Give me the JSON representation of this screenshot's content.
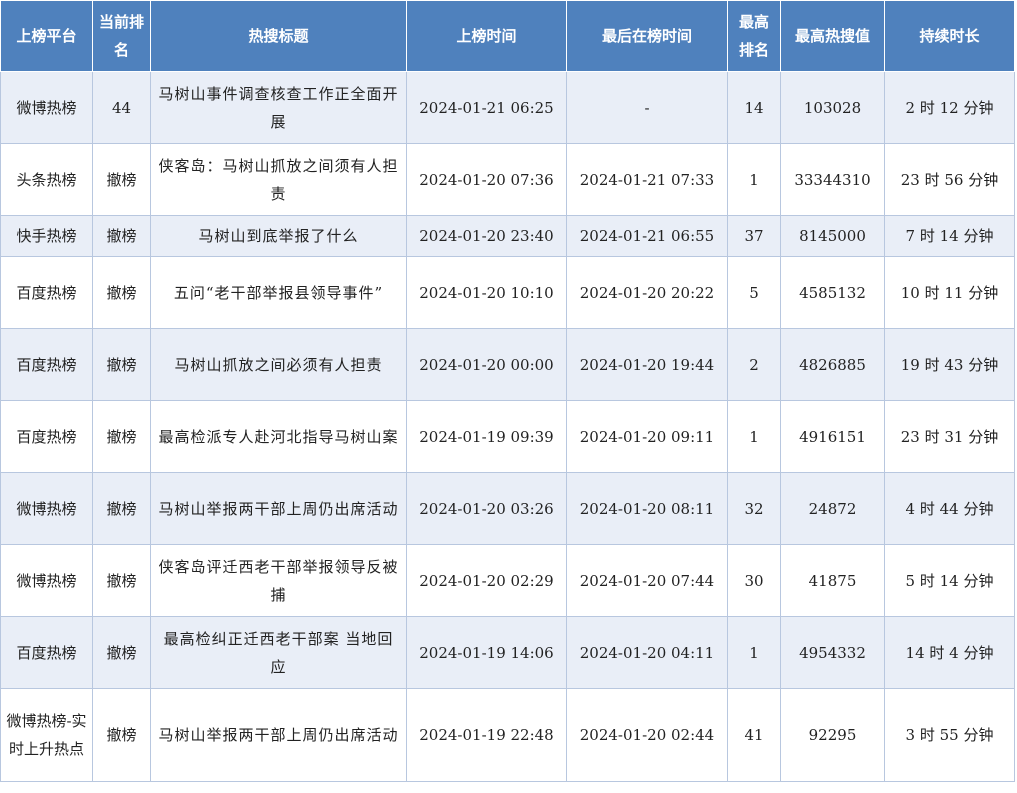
{
  "headers": {
    "platform": "上榜平台",
    "current_rank": "当前排名",
    "title": "热搜标题",
    "on_time": "上榜时间",
    "last_time": "最后在榜时间",
    "max_rank": "最高排名",
    "max_heat": "最高热搜值",
    "duration": "持续时长"
  },
  "rows": [
    {
      "platform": "微博热榜",
      "current_rank": "44",
      "title": "马树山事件调查核查工作正全面开展",
      "on_time": "2024-01-21 06:25",
      "last_time": "-",
      "max_rank": "14",
      "max_heat": "103028",
      "duration": "2 时 12 分钟"
    },
    {
      "platform": "头条热榜",
      "current_rank": "撤榜",
      "title": "侠客岛：马树山抓放之间须有人担责",
      "on_time": "2024-01-20 07:36",
      "last_time": "2024-01-21 07:33",
      "max_rank": "1",
      "max_heat": "33344310",
      "duration": "23 时 56 分钟"
    },
    {
      "platform": "快手热榜",
      "current_rank": "撤榜",
      "title": "马树山到底举报了什么",
      "on_time": "2024-01-20 23:40",
      "last_time": "2024-01-21 06:55",
      "max_rank": "37",
      "max_heat": "8145000",
      "duration": "7 时 14 分钟"
    },
    {
      "platform": "百度热榜",
      "current_rank": "撤榜",
      "title": "五问“老干部举报县领导事件”",
      "on_time": "2024-01-20 10:10",
      "last_time": "2024-01-20 20:22",
      "max_rank": "5",
      "max_heat": "4585132",
      "duration": "10 时 11 分钟"
    },
    {
      "platform": "百度热榜",
      "current_rank": "撤榜",
      "title": "马树山抓放之间必须有人担责",
      "on_time": "2024-01-20 00:00",
      "last_time": "2024-01-20 19:44",
      "max_rank": "2",
      "max_heat": "4826885",
      "duration": "19 时 43 分钟"
    },
    {
      "platform": "百度热榜",
      "current_rank": "撤榜",
      "title": "最高检派专人赴河北指导马树山案",
      "on_time": "2024-01-19 09:39",
      "last_time": "2024-01-20 09:11",
      "max_rank": "1",
      "max_heat": "4916151",
      "duration": "23 时 31 分钟"
    },
    {
      "platform": "微博热榜",
      "current_rank": "撤榜",
      "title": "马树山举报两干部上周仍出席活动",
      "on_time": "2024-01-20 03:26",
      "last_time": "2024-01-20 08:11",
      "max_rank": "32",
      "max_heat": "24872",
      "duration": "4 时 44 分钟"
    },
    {
      "platform": "微博热榜",
      "current_rank": "撤榜",
      "title": "侠客岛评迁西老干部举报领导反被捕",
      "on_time": "2024-01-20 02:29",
      "last_time": "2024-01-20 07:44",
      "max_rank": "30",
      "max_heat": "41875",
      "duration": "5 时 14 分钟"
    },
    {
      "platform": "百度热榜",
      "current_rank": "撤榜",
      "title": "最高检纠正迁西老干部案 当地回应",
      "on_time": "2024-01-19 14:06",
      "last_time": "2024-01-20 04:11",
      "max_rank": "1",
      "max_heat": "4954332",
      "duration": "14 时 4 分钟"
    },
    {
      "platform": "微博热榜-实时上升热点",
      "current_rank": "撤榜",
      "title": "马树山举报两干部上周仍出席活动",
      "on_time": "2024-01-19 22:48",
      "last_time": "2024-01-20 02:44",
      "max_rank": "41",
      "max_heat": "92295",
      "duration": "3 时 55 分钟"
    }
  ]
}
